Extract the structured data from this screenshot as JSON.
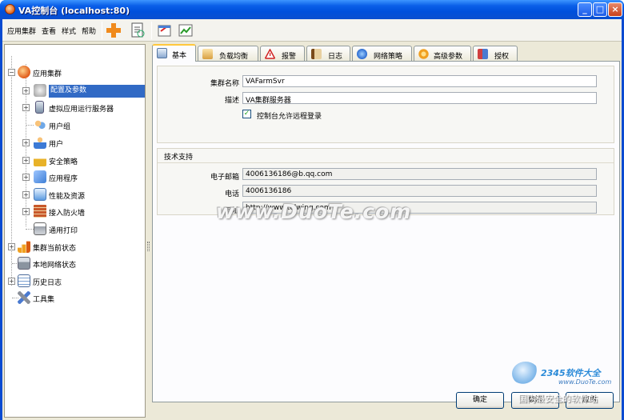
{
  "window": {
    "title": "VA控制台 (localhost:80)"
  },
  "menu": [
    "应用集群",
    "查看",
    "样式",
    "帮助"
  ],
  "tree": {
    "root": "应用集群",
    "children": [
      "配置及参数",
      "虚拟应用运行服务器",
      "用户组",
      "用户",
      "安全策略",
      "应用程序",
      "性能及资源",
      "接入防火墙",
      "通用打印"
    ],
    "siblings": [
      "集群当前状态",
      "本地网络状态",
      "历史日志",
      "工具集"
    ]
  },
  "tabs": [
    "基本",
    "负载均衡",
    "报警",
    "日志",
    "网络策略",
    "高级参数",
    "授权"
  ],
  "basic": {
    "name_label": "集群名称",
    "name_value": "VAFarmSvr",
    "desc_label": "描述",
    "desc_value": "VA集群服务器",
    "remote_login_label": "控制台允许远程登录",
    "remote_login_checked": "✓"
  },
  "support": {
    "title": "技术支持",
    "email_label": "电子邮箱",
    "email_value": "4006136186@b.qq.com",
    "phone_label": "电话",
    "phone_value": "4006136186",
    "url_label": "网址",
    "url_value": "http://www.telwing.com"
  },
  "buttons": {
    "ok": "确定",
    "cancel": "取消",
    "apply": "应用"
  },
  "watermark": "www.DuoTe.com",
  "brand": {
    "name": "2345软件大全",
    "url": "www.DuoTe.com",
    "slogan": "国内最安全的软件站"
  },
  "colors": {
    "title_blue": "#0a5fe8",
    "selection": "#316ac5",
    "tab_active": "#ffc83c"
  }
}
